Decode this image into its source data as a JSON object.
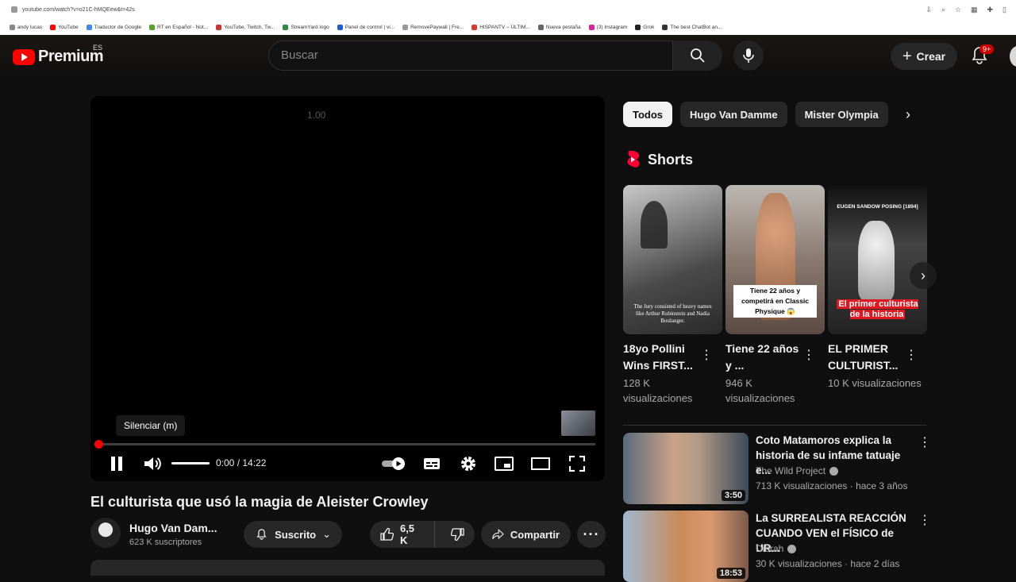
{
  "browser": {
    "url": "youtube.com/watch?v=o21C-hMQEew&t=42s",
    "bookmarks": [
      {
        "label": "andy lucas",
        "color": "#888888"
      },
      {
        "label": "YouTube",
        "color": "#ff0000"
      },
      {
        "label": "Traductor de Google",
        "color": "#4285f4"
      },
      {
        "label": "RT en Español - Not...",
        "color": "#5aa02c"
      },
      {
        "label": "YouTube, Twitch, Tw...",
        "color": "#cc3333"
      },
      {
        "label": "StreamYard logo",
        "color": "#2d8a3e"
      },
      {
        "label": "Panel de control | vi...",
        "color": "#1e5bd6"
      },
      {
        "label": "RemovePaywall | Fre...",
        "color": "#999999"
      },
      {
        "label": "HISPANTV – ÚLTIM...",
        "color": "#d43a2f"
      },
      {
        "label": "Nueva pestaña",
        "color": "#666666"
      },
      {
        "label": "(3) Instagram",
        "color": "#d6249f"
      },
      {
        "label": "Grok",
        "color": "#222222"
      },
      {
        "label": "The best ChatBot an...",
        "color": "#333333"
      }
    ]
  },
  "masthead": {
    "logo_text": "Premium",
    "country": "ES",
    "search_placeholder": "Buscar",
    "create_label": "Crear",
    "notifications_badge": "9+"
  },
  "player": {
    "speed_overlay": "1.00",
    "tooltip": "Silenciar (m)",
    "time": "0:00 / 14:22",
    "progress": 0.0,
    "volume": 1.0
  },
  "video": {
    "title": "El culturista que usó la magia de Aleister Crowley",
    "channel": "Hugo Van Dam...",
    "subscribers": "623 K suscriptores",
    "subscribed_label": "Suscrito",
    "likes": "6,5 K",
    "share_label": "Compartir"
  },
  "chips": [
    "Todos",
    "Hugo Van Damme",
    "Mister Olympia"
  ],
  "shorts": {
    "heading": "Shorts",
    "items": [
      {
        "title": "18yo Pollini Wins FIRST...",
        "views": "128 K visualizaciones",
        "overlay": "The Jury consisted of heavy names like Arthur Rubinstein and Nadia Boulanger."
      },
      {
        "title": "Tiene 22 años y ...",
        "views": "946 K visualizaciones",
        "overlay": "Tiene 22 años y competirá en Classic Physique 😱"
      },
      {
        "title": "EL PRIMER CULTURIST...",
        "views": "10 K visualizaciones",
        "overlay": "El primer culturista de la historia",
        "top_caption": "EUGEN SANDOW POSING [1894]"
      }
    ]
  },
  "recommendations": [
    {
      "title": "Coto Matamoros explica la historia de su infame tatuaje e...",
      "channel": "The Wild Project",
      "meta": "713 K visualizaciones · hace 3 años",
      "duration": "3:50"
    },
    {
      "title": "La SURREALISTA REACCIÓN CUANDO VEN el FÍSICO de UR...",
      "channel": "Dibrah",
      "meta": "30 K visualizaciones · hace 2 días",
      "duration": "18:53"
    }
  ]
}
